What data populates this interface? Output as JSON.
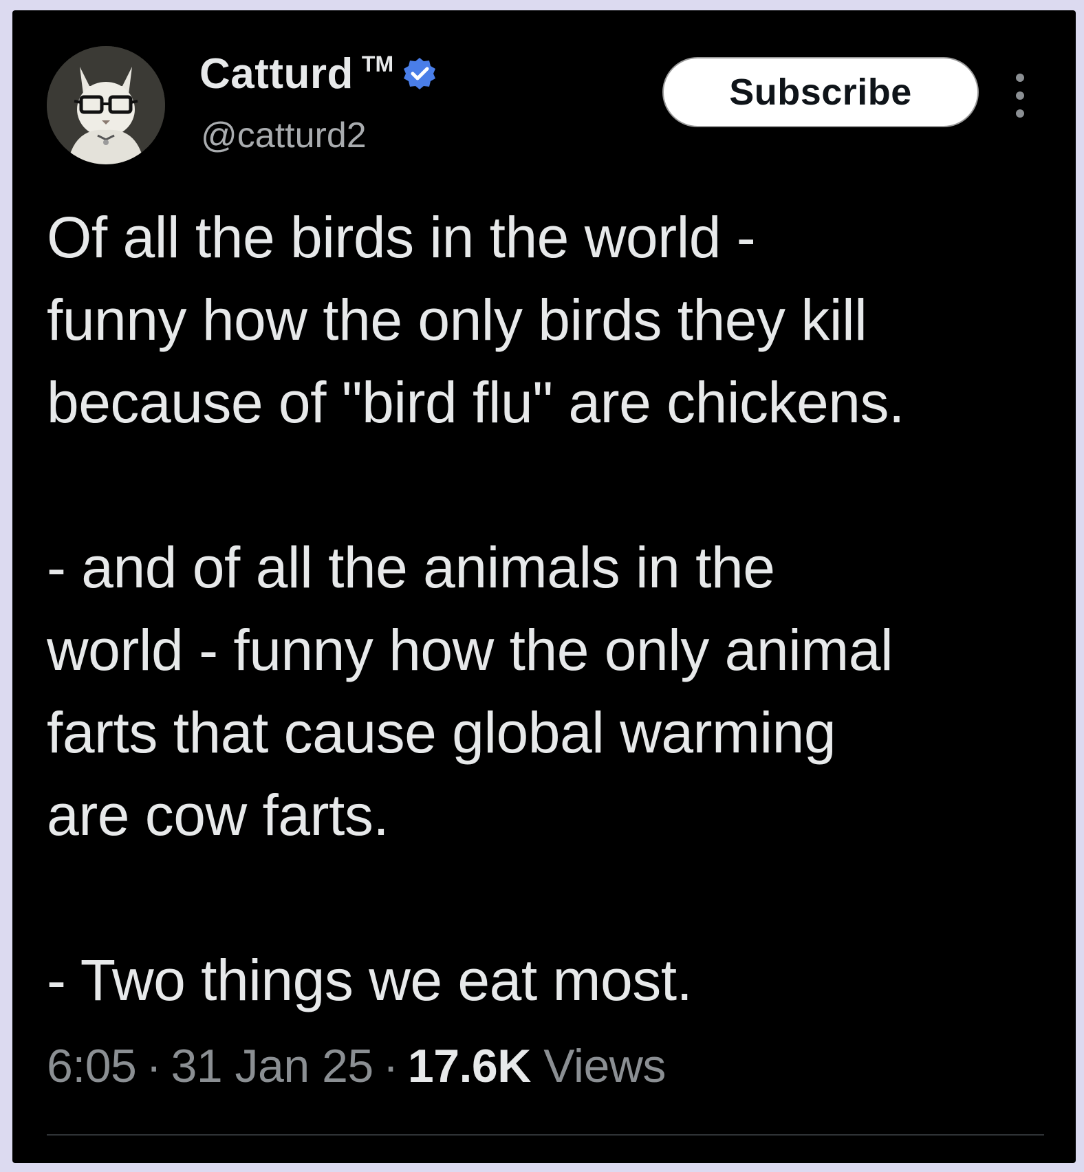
{
  "tweet": {
    "author": {
      "display_name": "Catturd",
      "trademark": "TM",
      "handle": "@catturd2",
      "verified": true,
      "verified_badge_color": "#4a7ee8",
      "avatar_icon": "cat-with-glasses-avatar"
    },
    "subscribe_label": "Subscribe",
    "more_icon": "more-vertical-icon",
    "body": {
      "paragraph1": [
        "Of all the birds in the world -",
        "funny how the only birds they kill",
        "because of \"bird flu\" are chickens."
      ],
      "paragraph2": [
        "- and of all the animals in the",
        "world - funny how the only animal",
        "farts that cause global warming",
        "are cow farts."
      ],
      "paragraph3": [
        "- Two things we eat most."
      ]
    },
    "meta": {
      "time": "6:05",
      "separator": "·",
      "date": "31 Jan 25",
      "views_count": "17.6K",
      "views_label": "Views"
    }
  },
  "colors": {
    "background": "#000000",
    "text_primary": "#e7e9ea",
    "text_secondary": "#8b8f93",
    "frame": "#dcdaf0"
  }
}
